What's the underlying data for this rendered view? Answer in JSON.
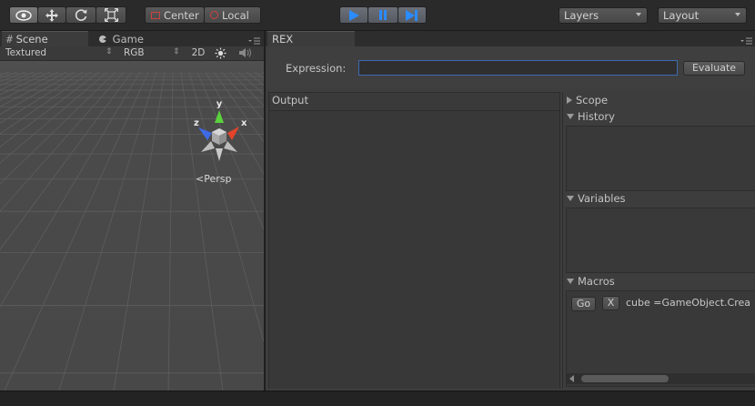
{
  "toolbar": {
    "pivot": {
      "center_label": "Center",
      "local_label": "Local"
    },
    "layers_label": "Layers",
    "layout_label": "Layout",
    "colors": {
      "play_accent": "#2b8cff"
    }
  },
  "scene_panel": {
    "tabs": [
      {
        "label": "Scene"
      },
      {
        "label": "Game"
      }
    ],
    "bar": {
      "shading_mode": "Textured",
      "render_mode": "RGB",
      "mode_2d": "2D"
    },
    "gizmo": {
      "y_label": "y",
      "x_label": "x",
      "z_label": "z",
      "persp_label": "Persp"
    }
  },
  "rex_panel": {
    "tab_label": "REX",
    "expression_label": "Expression:",
    "expression_value": "",
    "evaluate_label": "Evaluate",
    "output_label": "Output",
    "sections": {
      "scope": "Scope",
      "history": "History",
      "variables": "Variables",
      "macros": "Macros"
    },
    "macro_row": {
      "go_label": "Go",
      "remove_label": "X",
      "code": "cube =GameObject.Crea"
    }
  }
}
